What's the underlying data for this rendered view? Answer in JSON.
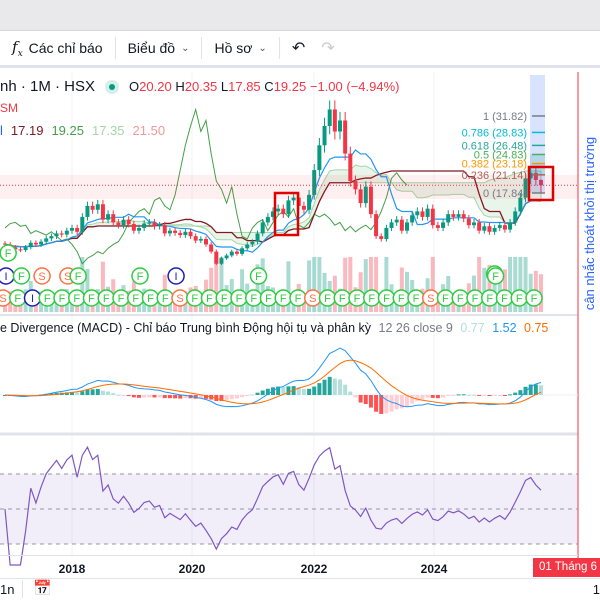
{
  "toolbar": {
    "indicators_label": "Các chỉ báo",
    "chart_label": "Biểu đồ",
    "profile_label": "Hồ sơ"
  },
  "legend": {
    "symbol": "nh · 1M · HSX",
    "open_label": "O",
    "open": "20.20",
    "high_label": "H",
    "high": "20.35",
    "low_label": "L",
    "low": "17.85",
    "close_label": "C",
    "close": "19.25",
    "change": "−1.00 (−4.94%)",
    "line2": "SM",
    "ind_values": [
      "l",
      "17.19",
      "19.25",
      "17.35",
      "21.50"
    ]
  },
  "macd": {
    "label": "e Divergence (MACD) - Chỉ báo Trung bình Động hội tụ và phân kỳ",
    "params": "12 26 close 9",
    "hist": "0.77",
    "macd": "1.52",
    "signal": "0.75"
  },
  "annotation": "cân nhắc thoát khỏi thị trường",
  "xaxis": {
    "years": [
      "2018",
      "2020",
      "2022",
      "2024"
    ],
    "cursor_date": "01 Tháng 6 '"
  },
  "bottombar": {
    "left": "1n",
    "right": "1"
  },
  "colors": {
    "up": "#089981",
    "down": "#f23645",
    "accent": "#2962ff",
    "rsi": "#7e57c2"
  },
  "chart_data": {
    "type": "candlestick",
    "interval": "1M",
    "start": "2016-10",
    "close": [
      8.5,
      8.0,
      7.6,
      7.5,
      8.0,
      8.8,
      8.5,
      9.0,
      9.6,
      10.0,
      10.5,
      10.3,
      11.0,
      11.5,
      10.8,
      13.5,
      15.5,
      14.8,
      15.8,
      13.0,
      14.0,
      12.5,
      12.0,
      13.0,
      12.2,
      11.0,
      11.5,
      12.3,
      12.5,
      11.8,
      12.0,
      10.5,
      11.0,
      10.6,
      10.2,
      10.8,
      10.0,
      9.2,
      9.5,
      8.5,
      7.2,
      5.0,
      6.0,
      6.5,
      7.2,
      6.8,
      7.8,
      8.5,
      9.0,
      10.5,
      12.5,
      13.5,
      14.5,
      15.0,
      14.0,
      16.5,
      17.0,
      15.5,
      14.8,
      17.5,
      22.0,
      26.5,
      30.0,
      33.0,
      29.0,
      31.0,
      25.0,
      20.0,
      18.5,
      16.0,
      19.0,
      14.0,
      10.0,
      9.5,
      11.5,
      12.5,
      13.0,
      11.0,
      12.5,
      13.8,
      14.5,
      13.5,
      15.0,
      12.0,
      11.5,
      12.5,
      14.0,
      13.5,
      14.0,
      13.2,
      12.0,
      12.5,
      11.0,
      11.8,
      10.8,
      11.5,
      12.0,
      11.2,
      12.5,
      14.5,
      17.0,
      20.5,
      21.5,
      20.2,
      19.25
    ],
    "last": {
      "open": 20.2,
      "high": 20.35,
      "low": 17.85,
      "close": 19.25
    },
    "fibonacci": [
      {
        "level": "1",
        "price": 31.82,
        "color": "#787b86"
      },
      {
        "level": "0.786",
        "price": 28.83,
        "color": "#00bcd4"
      },
      {
        "level": "0.618",
        "price": 26.48,
        "color": "#26a69a"
      },
      {
        "level": "0.5",
        "price": 24.83,
        "color": "#4caf50"
      },
      {
        "level": "0.382",
        "price": 23.18,
        "color": "#ff9800"
      },
      {
        "level": "0.236",
        "price": 21.14,
        "color": "#b2605b"
      },
      {
        "level": "0",
        "price": 17.84,
        "color": "#787b86"
      }
    ],
    "signals_row1": [
      {
        "i": 1,
        "t": "F"
      }
    ],
    "signals_row2": [
      {
        "i": 0,
        "t": "I"
      },
      {
        "i": 3,
        "t": "F"
      },
      {
        "i": 7,
        "t": "S"
      },
      {
        "i": 12,
        "t": "S"
      },
      {
        "i": 14,
        "t": "F"
      },
      {
        "i": 26,
        "t": "F"
      },
      {
        "i": 33,
        "t": "I"
      },
      {
        "i": 49,
        "t": "F"
      },
      {
        "i": 95,
        "t": "F"
      }
    ],
    "signals_row3": "SFIFFFFFFFFFSFFFFFFFFSFFFFFFFSFFFFFFF",
    "rsi_levels": [
      70,
      50,
      30
    ]
  }
}
